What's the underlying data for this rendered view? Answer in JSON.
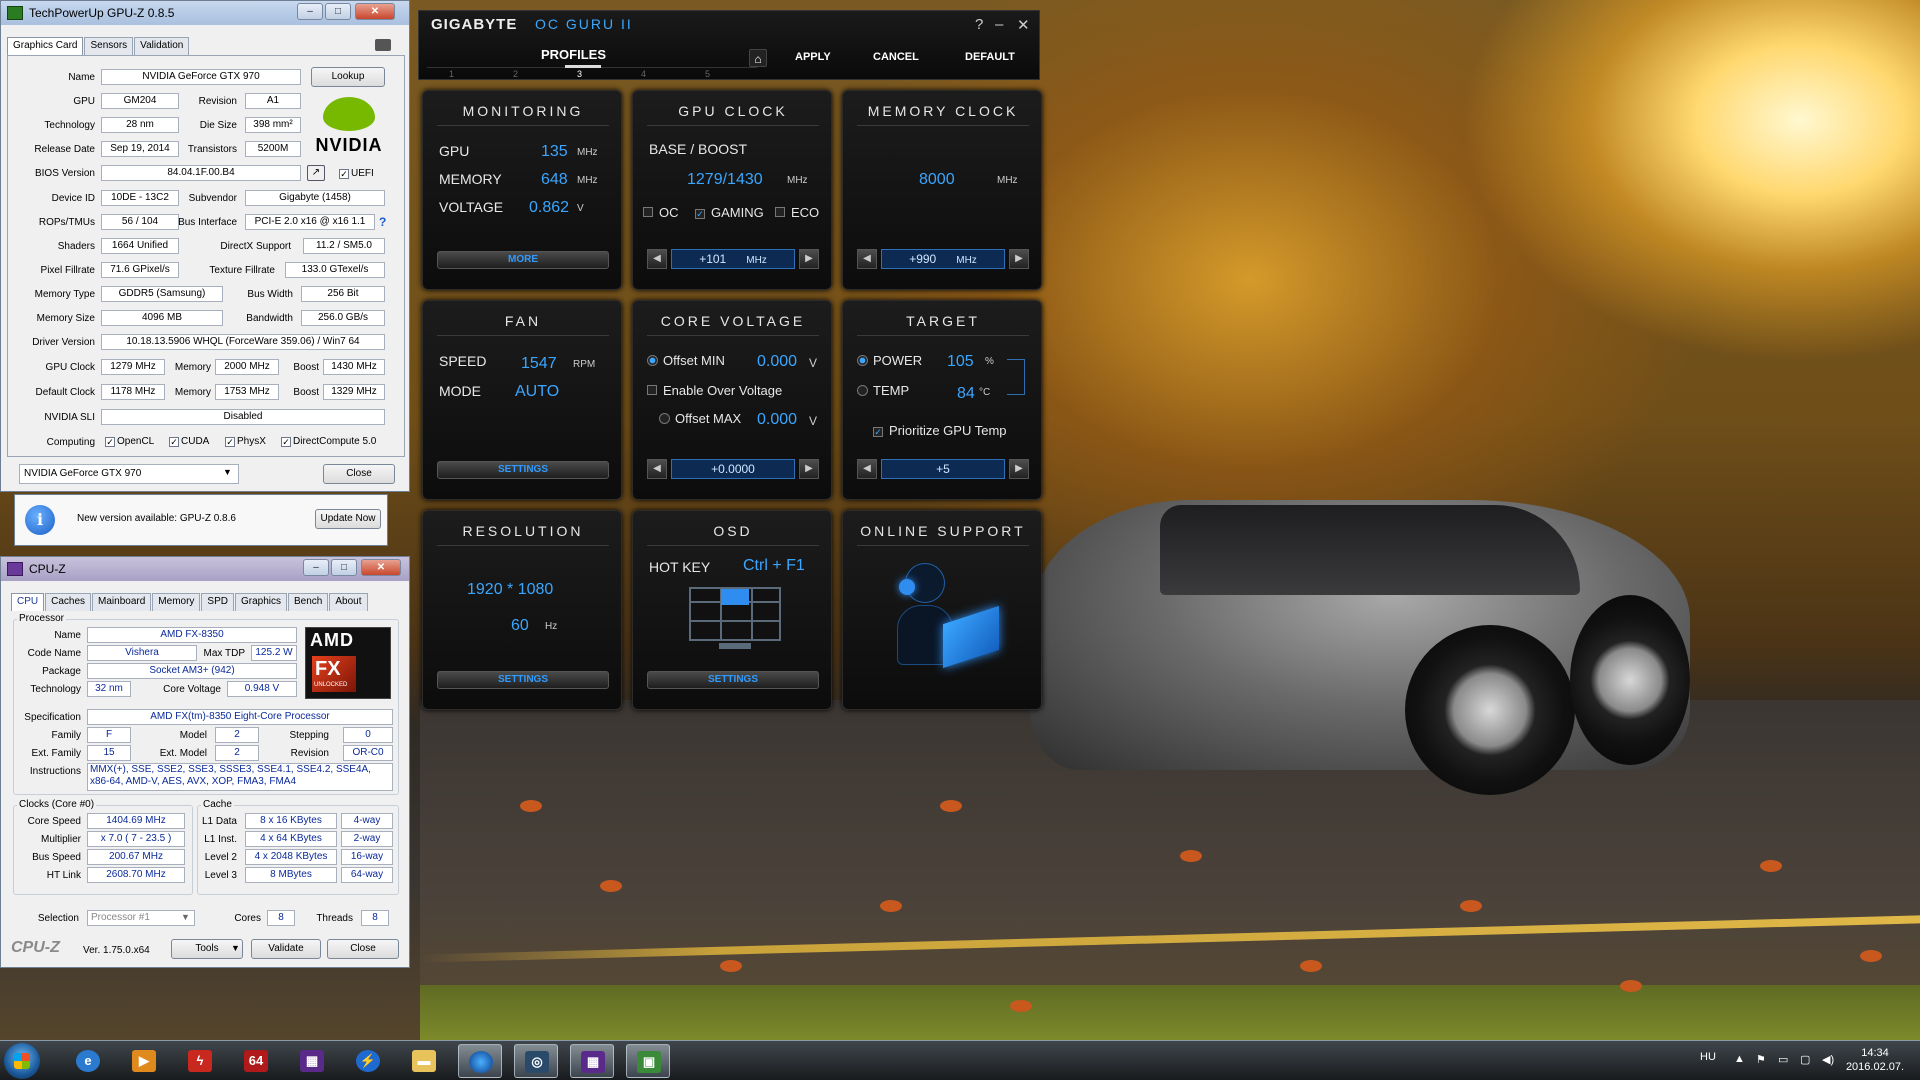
{
  "gpuz": {
    "title": "TechPowerUp GPU-Z 0.8.5",
    "tabs": [
      "Graphics Card",
      "Sensors",
      "Validation"
    ],
    "rows": [
      {
        "label": "Name",
        "value": "NVIDIA GeForce GTX 970"
      },
      {
        "label": "GPU",
        "value": "GM204",
        "label2": "Revision",
        "value2": "A1"
      },
      {
        "label": "Technology",
        "value": "28 nm",
        "label2": "Die Size",
        "value2": "398 mm²"
      },
      {
        "label": "Release Date",
        "value": "Sep 19, 2014",
        "label2": "Transistors",
        "value2": "5200M"
      },
      {
        "label": "BIOS Version",
        "value": "84.04.1F.00.B4"
      },
      {
        "label": "Device ID",
        "value": "10DE - 13C2",
        "label2": "Subvendor",
        "value2": "Gigabyte (1458)"
      },
      {
        "label": "ROPs/TMUs",
        "value": "56 / 104",
        "label2": "Bus Interface",
        "value2": "PCI-E 2.0 x16 @ x16 1.1"
      },
      {
        "label": "Shaders",
        "value": "1664 Unified",
        "label2": "DirectX Support",
        "value2": "11.2 / SM5.0"
      },
      {
        "label": "Pixel Fillrate",
        "value": "71.6 GPixel/s",
        "label2": "Texture Fillrate",
        "value2": "133.0 GTexel/s"
      },
      {
        "label": "Memory Type",
        "value": "GDDR5 (Samsung)",
        "label2": "Bus Width",
        "value2": "256 Bit"
      },
      {
        "label": "Memory Size",
        "value": "4096 MB",
        "label2": "Bandwidth",
        "value2": "256.0 GB/s"
      },
      {
        "label": "Driver Version",
        "value": "10.18.13.5906 WHQL (ForceWare 359.06) / Win7 64"
      }
    ],
    "gpu_clock": {
      "label": "GPU Clock",
      "value": "1279 MHz",
      "mem_label": "Memory",
      "mem": "2000 MHz",
      "boost_label": "Boost",
      "boost": "1430 MHz"
    },
    "default_clock": {
      "label": "Default Clock",
      "value": "1178 MHz",
      "mem_label": "Memory",
      "mem": "1753 MHz",
      "boost_label": "Boost",
      "boost": "1329 MHz"
    },
    "sli": {
      "label": "NVIDIA SLI",
      "value": "Disabled"
    },
    "computing": {
      "label": "Computing",
      "items": [
        "OpenCL",
        "CUDA",
        "PhysX",
        "DirectCompute 5.0"
      ]
    },
    "lookup": "Lookup",
    "uefi": "UEFI",
    "question": "?",
    "vendor_logo": "NVIDIA",
    "card_select": "NVIDIA GeForce GTX 970",
    "close": "Close",
    "update_text": "New version available: GPU-Z 0.8.6",
    "update_btn": "Update Now"
  },
  "cpuz": {
    "title": "CPU-Z",
    "tabs": [
      "CPU",
      "Caches",
      "Mainboard",
      "Memory",
      "SPD",
      "Graphics",
      "Bench",
      "About"
    ],
    "processor_group": "Processor",
    "name_label": "Name",
    "name": "AMD FX-8350",
    "codename_label": "Code Name",
    "codename": "Vishera",
    "maxtdp_label": "Max TDP",
    "maxtdp": "125.2 W",
    "package_label": "Package",
    "package": "Socket AM3+ (942)",
    "tech_label": "Technology",
    "tech": "32 nm",
    "corevolt_label": "Core Voltage",
    "corevolt": "0.948 V",
    "spec_label": "Specification",
    "spec": "AMD FX(tm)-8350 Eight-Core Processor",
    "family_label": "Family",
    "family": "F",
    "model_label": "Model",
    "model": "2",
    "stepping_label": "Stepping",
    "stepping": "0",
    "extfamily_label": "Ext. Family",
    "extfamily": "15",
    "extmodel_label": "Ext. Model",
    "extmodel": "2",
    "revision_label": "Revision",
    "revision": "OR-C0",
    "instr_label": "Instructions",
    "instr_line1": "MMX(+), SSE, SSE2, SSE3, SSSE3, SSE4.1, SSE4.2, SSE4A,",
    "instr_line2": "x86-64, AMD-V, AES, AVX, XOP, FMA3, FMA4",
    "clocks_group": "Clocks (Core #0)",
    "cache_group": "Cache",
    "corespeed_label": "Core Speed",
    "corespeed": "1404.69 MHz",
    "mult_label": "Multiplier",
    "mult": "x 7.0 ( 7 - 23.5 )",
    "busspeed_label": "Bus Speed",
    "busspeed": "200.67 MHz",
    "htlink_label": "HT Link",
    "htlink": "2608.70 MHz",
    "l1d_label": "L1 Data",
    "l1d": "8 x 16 KBytes",
    "l1d_way": "4-way",
    "l1i_label": "L1 Inst.",
    "l1i": "4 x 64 KBytes",
    "l1i_way": "2-way",
    "l2_label": "Level 2",
    "l2": "4 x 2048 KBytes",
    "l2_way": "16-way",
    "l3_label": "Level 3",
    "l3": "8 MBytes",
    "l3_way": "64-way",
    "selection_label": "Selection",
    "selection": "Processor #1",
    "cores_label": "Cores",
    "cores": "8",
    "threads_label": "Threads",
    "threads": "8",
    "brand": "CPU-Z",
    "version": "Ver. 1.75.0.x64",
    "tools": "Tools",
    "validate": "Validate",
    "close": "Close",
    "logo_amd": "AMD",
    "logo_fx": "FX",
    "logo_unlocked": "UNLOCKED"
  },
  "ocguru": {
    "brand": "GIGABYTE",
    "product": "OC GURU II",
    "help": "?",
    "minimize": "–",
    "close": "✕",
    "profiles": "PROFILES",
    "profile_numbers": [
      "1",
      "2",
      "3",
      "4",
      "5"
    ],
    "apply": "APPLY",
    "cancel": "CANCEL",
    "default": "DEFAULT",
    "monitoring": {
      "title": "MONITORING",
      "gpu_label": "GPU",
      "gpu": "135",
      "gpu_unit": "MHz",
      "mem_label": "MEMORY",
      "mem": "648",
      "mem_unit": "MHz",
      "volt_label": "VOLTAGE",
      "volt": "0.862",
      "volt_unit": "V",
      "more": "MORE"
    },
    "gpuclock": {
      "title": "GPU CLOCK",
      "base_label": "BASE / BOOST",
      "value": "1279/1430",
      "unit": "MHz",
      "oc": "OC",
      "gaming": "GAMING",
      "eco": "ECO",
      "offset": "+101",
      "offset_unit": "MHz"
    },
    "memclock": {
      "title": "MEMORY CLOCK",
      "value": "8000",
      "unit": "MHz",
      "offset": "+990",
      "offset_unit": "MHz"
    },
    "fan": {
      "title": "FAN",
      "speed_label": "SPEED",
      "speed": "1547",
      "speed_unit": "RPM",
      "mode_label": "MODE",
      "mode": "AUTO",
      "settings": "SETTINGS"
    },
    "corevolt": {
      "title": "CORE VOLTAGE",
      "offset_min_label": "Offset MIN",
      "offset_min": "0.000",
      "unit": "V",
      "enable_over": "Enable Over Voltage",
      "offset_max_label": "Offset MAX",
      "offset_max": "0.000",
      "spin": "+0.0000"
    },
    "target": {
      "title": "TARGET",
      "power_label": "POWER",
      "power": "105",
      "power_unit": "%",
      "temp_label": "TEMP",
      "temp": "84",
      "temp_unit": "°C",
      "prioritize": "Prioritize GPU Temp",
      "spin": "+5"
    },
    "resolution": {
      "title": "RESOLUTION",
      "value": "1920 * 1080",
      "hz": "60",
      "hz_unit": "Hz",
      "settings": "SETTINGS"
    },
    "osd": {
      "title": "OSD",
      "hotkey_label": "HOT KEY",
      "hotkey": "Ctrl + F1",
      "settings": "SETTINGS"
    },
    "online": {
      "title": "ONLINE SUPPORT"
    }
  },
  "taskbar": {
    "lang": "HU",
    "time": "14:34",
    "date": "2016.02.07."
  }
}
